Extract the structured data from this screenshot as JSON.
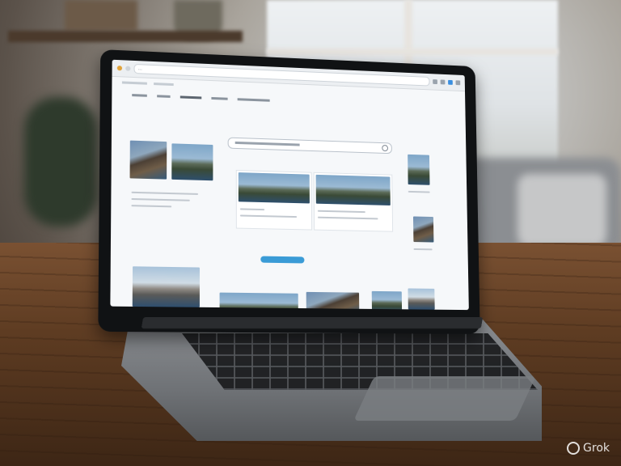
{
  "browser": {
    "url": "…",
    "icons": [
      "back-icon",
      "forward-icon",
      "refresh-icon",
      "menu-icon"
    ]
  },
  "screen": {
    "nav": [
      "…",
      "…",
      "…",
      "…"
    ],
    "search_placeholder": "…",
    "cta_label": "…"
  },
  "watermark": "Grok"
}
